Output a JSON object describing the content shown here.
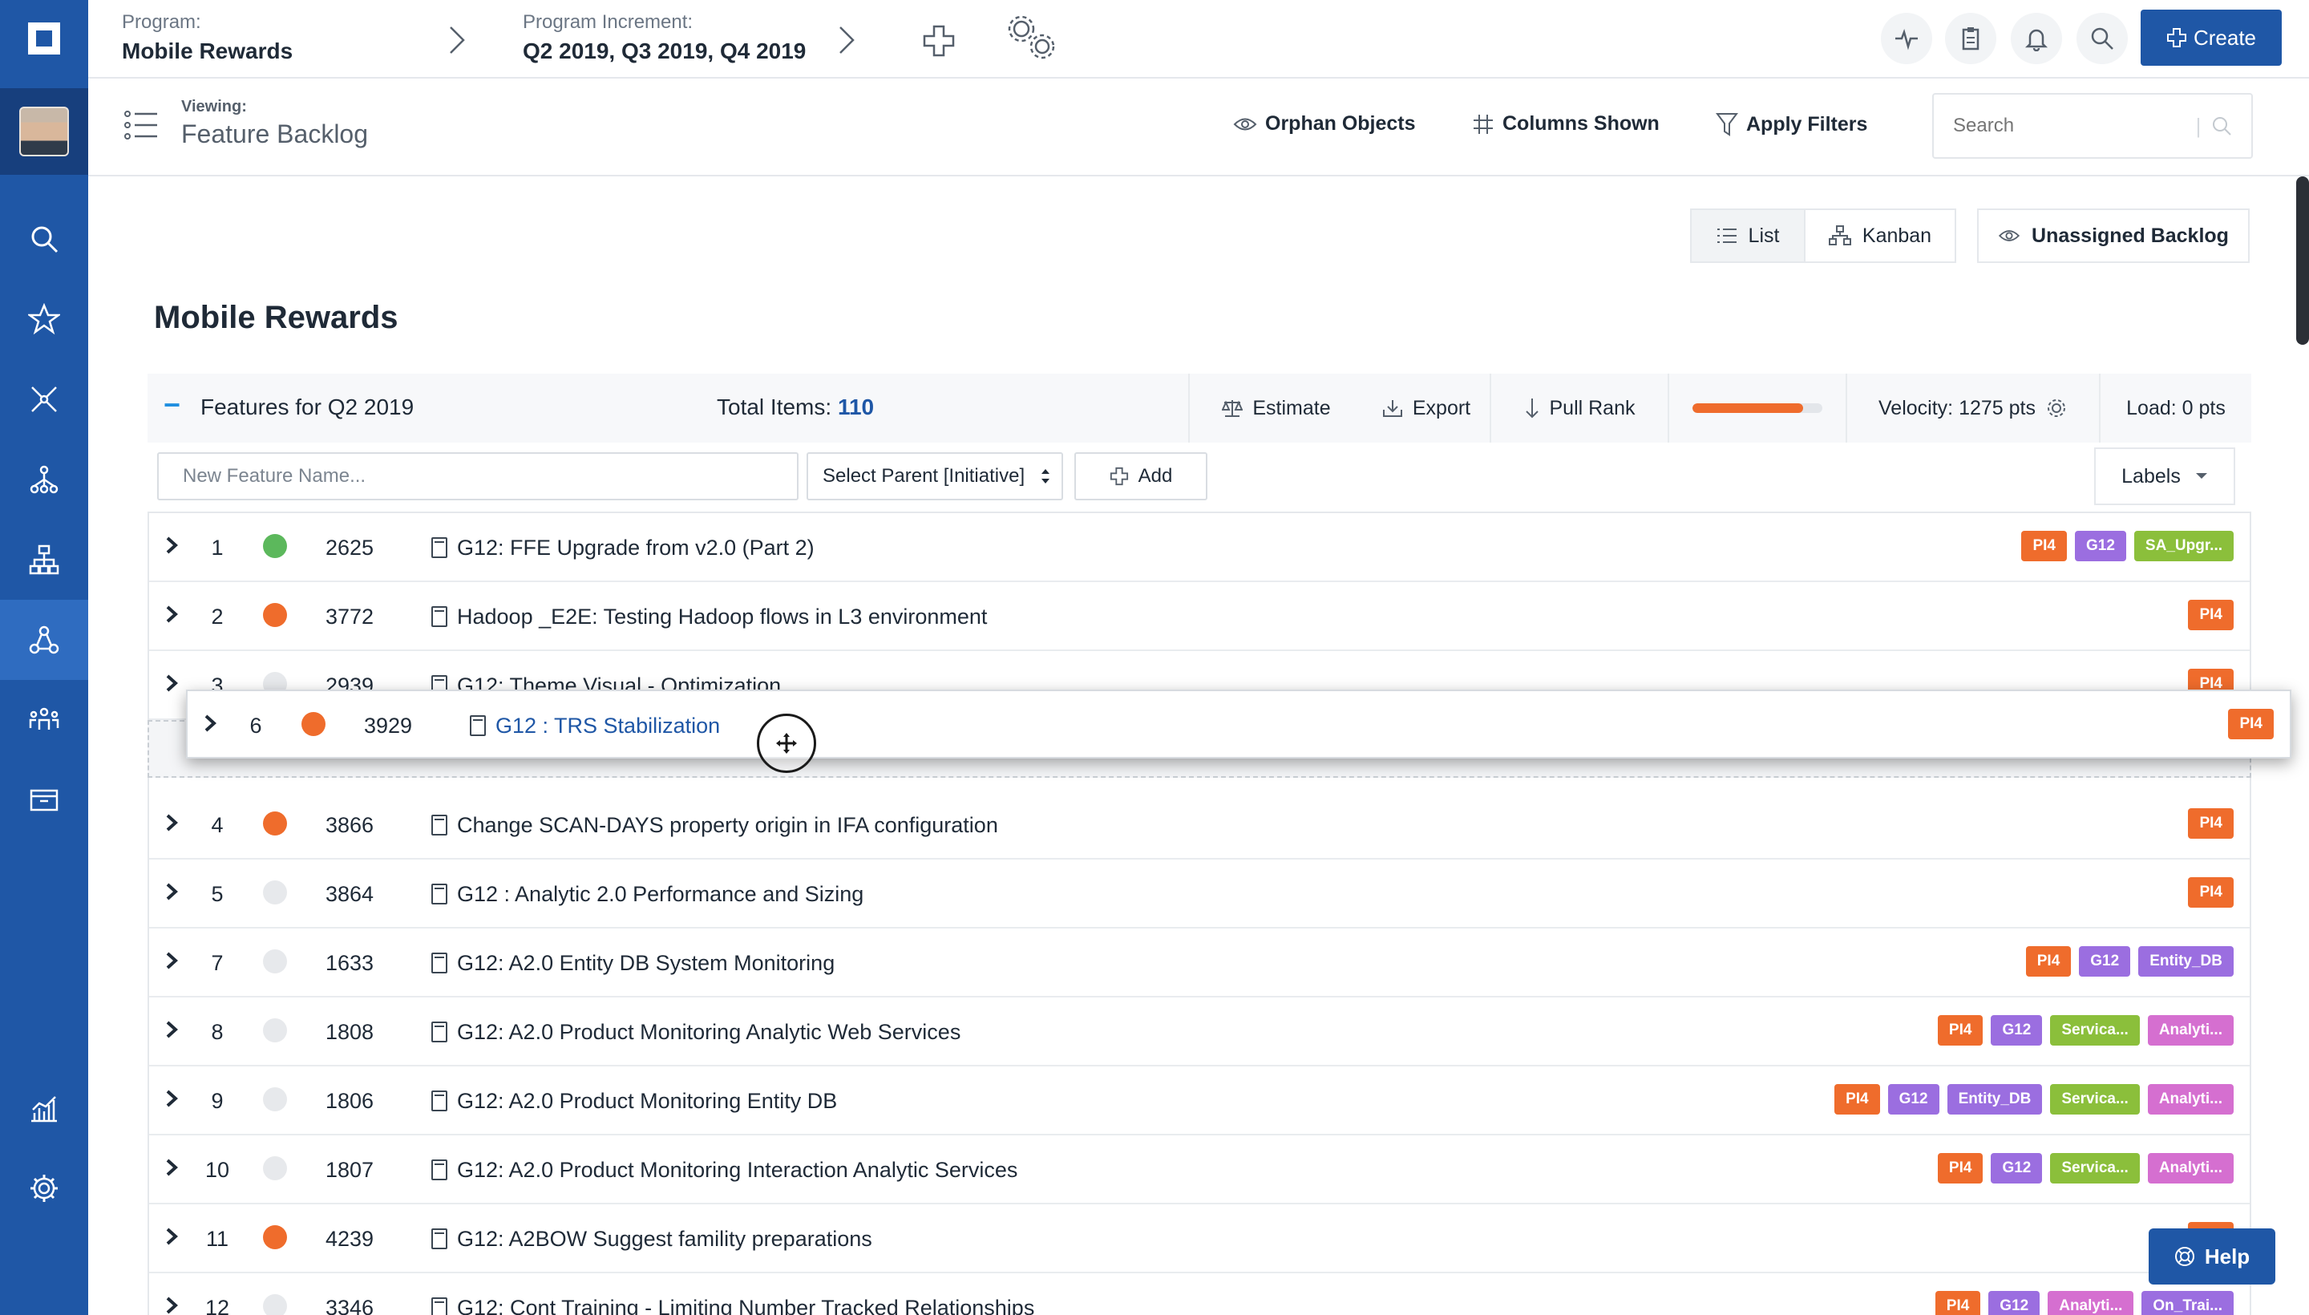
{
  "topbar": {
    "program_label": "Program:",
    "program_value": "Mobile Rewards",
    "increment_label": "Program Increment:",
    "increment_value": "Q2 2019, Q3 2019, Q4 2019",
    "create_label": "Create"
  },
  "subbar": {
    "viewing_label": "Viewing:",
    "viewing_value": "Feature Backlog",
    "orphan_label": "Orphan Objects",
    "columns_label": "Columns Shown",
    "filters_label": "Apply Filters",
    "search_placeholder": "Search"
  },
  "views": {
    "list_label": "List",
    "kanban_label": "Kanban",
    "unassigned_label": "Unassigned Backlog"
  },
  "page_title": "Mobile Rewards",
  "section": {
    "collapse_glyph": "−",
    "features_prefix": "Features for",
    "quarter": "Q2 2019",
    "total_label": "Total Items:",
    "total_value": "110",
    "estimate_label": "Estimate",
    "export_label": "Export",
    "pull_rank_label": "Pull Rank",
    "progress_fraction": 0.85,
    "progress_color": "#ef6c2c",
    "velocity_label": "Velocity: 1275 pts",
    "load_label": "Load: 0 pts"
  },
  "add_row": {
    "new_feature_placeholder": "New Feature Name...",
    "parent_select_value": "Select Parent [Initiative]",
    "add_label": "Add",
    "labels_label": "Labels"
  },
  "colors": {
    "brand": "#1f57a6",
    "dot_green": "#5cb85c",
    "dot_orange": "#ef6c2c",
    "dot_none": "#e7e9ec",
    "tag_pi": "#ef6c2c",
    "tag_group": "#9b6ee0",
    "tag_green": "#8bbf3b",
    "tag_pink": "#d56fd0"
  },
  "rows": [
    {
      "rank": "1",
      "status": "green",
      "id": "2625",
      "title": "G12: FFE Upgrade from v2.0 (Part 2)",
      "tags": [
        {
          "text": "PI4",
          "kind": "pi"
        },
        {
          "text": "G12",
          "kind": "group"
        },
        {
          "text": "SA_Upgr...",
          "kind": "green"
        }
      ]
    },
    {
      "rank": "2",
      "status": "orange",
      "id": "3772",
      "title": "Hadoop _E2E: Testing Hadoop flows in L3 environment",
      "tags": [
        {
          "text": "PI4",
          "kind": "pi"
        }
      ]
    },
    {
      "rank": "3",
      "status": "none",
      "id": "2939",
      "title": "G12: Theme Visual - Optimization",
      "tags": [
        {
          "text": "PI4",
          "kind": "pi"
        }
      ]
    },
    {
      "rank": "4",
      "status": "orange",
      "id": "3866",
      "title": "Change SCAN-DAYS property origin in IFA configuration",
      "tags": [
        {
          "text": "PI4",
          "kind": "pi"
        }
      ]
    },
    {
      "rank": "5",
      "status": "none",
      "id": "3864",
      "title": "G12 : Analytic 2.0 Performance and Sizing",
      "tags": [
        {
          "text": "PI4",
          "kind": "pi"
        }
      ]
    },
    {
      "rank": "7",
      "status": "none",
      "id": "1633",
      "title": "G12: A2.0 Entity DB System Monitoring",
      "tags": [
        {
          "text": "PI4",
          "kind": "pi"
        },
        {
          "text": "G12",
          "kind": "group"
        },
        {
          "text": "Entity_DB",
          "kind": "group"
        }
      ]
    },
    {
      "rank": "8",
      "status": "none",
      "id": "1808",
      "title": "G12: A2.0 Product Monitoring Analytic Web Services",
      "tags": [
        {
          "text": "PI4",
          "kind": "pi"
        },
        {
          "text": "G12",
          "kind": "group"
        },
        {
          "text": "Servica...",
          "kind": "green"
        },
        {
          "text": "Analyti...",
          "kind": "pink"
        }
      ]
    },
    {
      "rank": "9",
      "status": "none",
      "id": "1806",
      "title": "G12: A2.0 Product Monitoring Entity DB",
      "tags": [
        {
          "text": "PI4",
          "kind": "pi"
        },
        {
          "text": "G12",
          "kind": "group"
        },
        {
          "text": "Entity_DB",
          "kind": "group"
        },
        {
          "text": "Servica...",
          "kind": "green"
        },
        {
          "text": "Analyti...",
          "kind": "pink"
        }
      ]
    },
    {
      "rank": "10",
      "status": "none",
      "id": "1807",
      "title": "G12: A2.0 Product Monitoring Interaction Analytic Services",
      "tags": [
        {
          "text": "PI4",
          "kind": "pi"
        },
        {
          "text": "G12",
          "kind": "group"
        },
        {
          "text": "Servica...",
          "kind": "green"
        },
        {
          "text": "Analyti...",
          "kind": "pink"
        }
      ]
    },
    {
      "rank": "11",
      "status": "orange",
      "id": "4239",
      "title": "G12: A2BOW Suggest famility preparations",
      "tags": [
        {
          "text": "PI4",
          "kind": "pi"
        }
      ]
    },
    {
      "rank": "12",
      "status": "none",
      "id": "3346",
      "title": "G12: Cont Training - Limiting Number Tracked Relationships",
      "tags": [
        {
          "text": "PI4",
          "kind": "pi"
        },
        {
          "text": "G12",
          "kind": "group"
        },
        {
          "text": "Analyti...",
          "kind": "pink"
        },
        {
          "text": "On_Trai...",
          "kind": "group"
        }
      ]
    }
  ],
  "dragged": {
    "rank": "6",
    "status": "orange",
    "id": "3929",
    "title": "G12 : TRS Stabilization",
    "tags": [
      {
        "text": "PI4",
        "kind": "pi"
      }
    ]
  },
  "help_label": "Help"
}
